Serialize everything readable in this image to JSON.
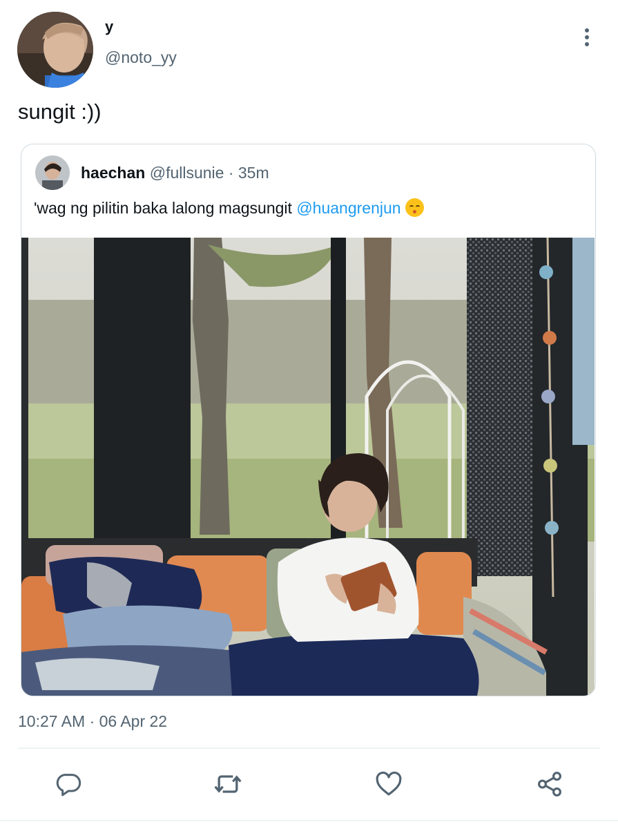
{
  "tweet": {
    "author": {
      "display_name": "y",
      "handle": "@noto_yy",
      "avatar_icon": "profile-photo"
    },
    "text": "sungit :))",
    "timestamp": "10:27 AM · 06 Apr 22"
  },
  "quoted_tweet": {
    "display_name": "haechan",
    "handle": "@fullsunie",
    "time_ago": " · 35m",
    "text": "'wag ng pilitin baka lalong magsungit ",
    "mention": "@huangrenjun",
    "emoji": "kissing-face-with-closed-eyes"
  },
  "actions": {
    "reply_icon": "speech-bubble-icon",
    "retweet_icon": "retweet-icon",
    "like_icon": "heart-icon",
    "share_icon": "share-icon"
  },
  "colors": {
    "mention": "#1d9bf0",
    "secondary_text": "#536471",
    "primary_text": "#0f1419",
    "border": "#cfd9de"
  }
}
